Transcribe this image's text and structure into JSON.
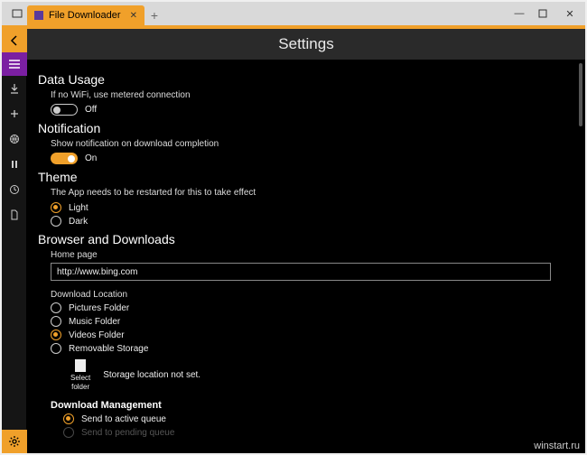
{
  "window": {
    "tab_title": "File Downloader",
    "watermark": "winstart.ru"
  },
  "header": {
    "title": "Settings"
  },
  "data_usage": {
    "heading": "Data Usage",
    "desc": "If no WiFi, use metered connection",
    "toggle_label": "Off",
    "toggle_on": false
  },
  "notification": {
    "heading": "Notification",
    "desc": "Show notification on download completion",
    "toggle_label": "On",
    "toggle_on": true
  },
  "theme": {
    "heading": "Theme",
    "desc": "The App needs to be restarted for this to take effect",
    "options": [
      "Light",
      "Dark"
    ],
    "selected": "Light"
  },
  "browser": {
    "heading": "Browser and Downloads",
    "home_label": "Home page",
    "home_value": "http://www.bing.com",
    "dl_label": "Download Location",
    "dl_options": [
      "Pictures Folder",
      "Music Folder",
      "Videos Folder",
      "Removable Storage"
    ],
    "dl_selected": "Videos Folder",
    "select_folder_label_1": "Select",
    "select_folder_label_2": "folder",
    "storage_msg": "Storage location not set.",
    "dm_heading": "Download Management",
    "dm_options": [
      "Send to active queue",
      "Send to pending queue"
    ],
    "dm_selected": "Send to active queue"
  },
  "colors": {
    "accent": "#f0a02a",
    "menu": "#7b1fa2"
  }
}
